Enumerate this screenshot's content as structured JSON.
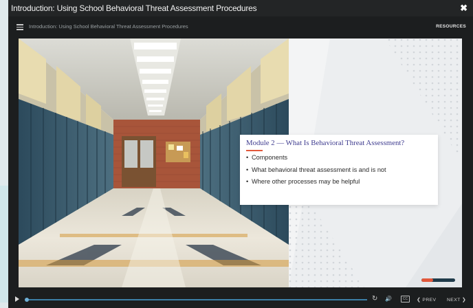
{
  "window": {
    "title": "Introduction: Using School Behavioral Threat Assessment Procedures",
    "close_glyph": "✖"
  },
  "topbar": {
    "menu_icon": "hamburger-menu-icon",
    "course_title": "Introduction: Using School Behavioral Threat Assessment Procedures",
    "resources_label": "RESOURCES"
  },
  "slide": {
    "image": "school-hallway-lockers",
    "heading": "Module 2 — What Is Behavioral Threat Assessment?",
    "bullets": [
      "Components",
      "What behavioral threat assessment is and is not",
      "Where other processes may be helpful"
    ],
    "slide_progress_fraction": 0.35,
    "colors": {
      "heading": "#3f3c8f",
      "accent": "#e2583b",
      "track": "#1f3a4a"
    }
  },
  "controls": {
    "play_icon": "play-icon",
    "seek_fraction": 0.0,
    "replay_glyph": "↻",
    "volume_glyph": "🔊",
    "cc_label": "CC",
    "prev_label": "❮ PREV",
    "next_label": "NEXT ❯",
    "seek_color": "#3c7fa8"
  }
}
